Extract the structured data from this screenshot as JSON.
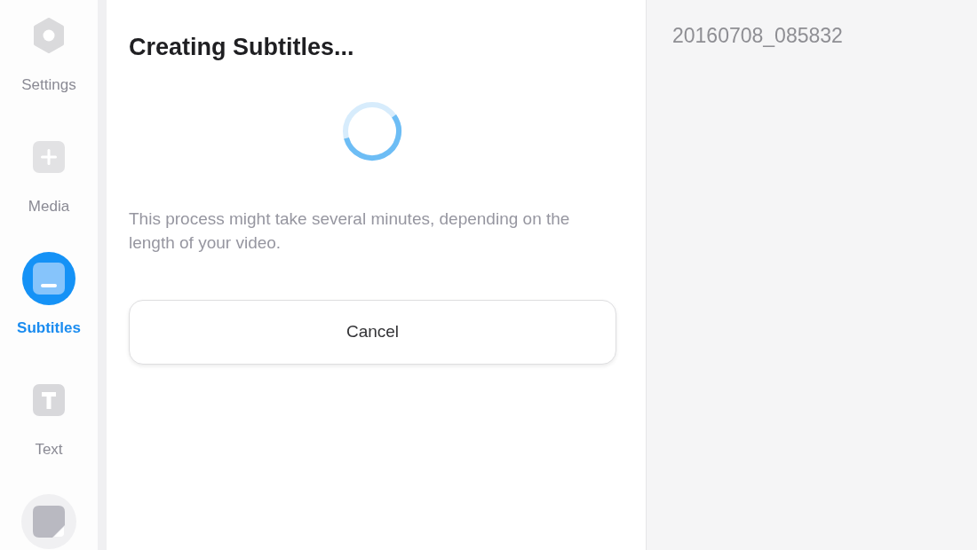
{
  "sidebar": {
    "items": [
      {
        "label": "Settings",
        "selected": false,
        "hovered": false
      },
      {
        "label": "Media",
        "selected": false,
        "hovered": false
      },
      {
        "label": "Subtitles",
        "selected": true,
        "hovered": false
      },
      {
        "label": "Text",
        "selected": false,
        "hovered": false
      },
      {
        "selected": false,
        "hovered": true
      }
    ]
  },
  "dialog": {
    "title": "Creating Subtitles...",
    "message": "This process might take several minutes, depending on the length of your video.",
    "cancel_button": "Cancel"
  },
  "preview": {
    "file_name": "20160708_085832"
  }
}
